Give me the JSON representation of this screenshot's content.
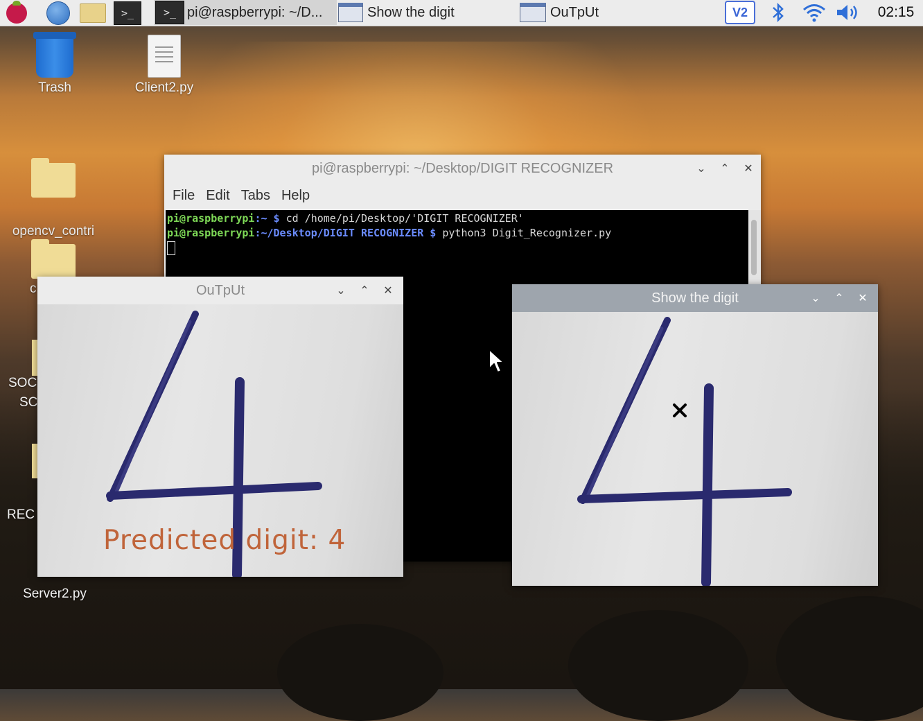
{
  "taskbar": {
    "tasks": [
      {
        "label": "pi@raspberrypi: ~/D...",
        "active": true
      },
      {
        "label": "Show the digit",
        "active": false
      },
      {
        "label": "OuTpUt",
        "active": false
      }
    ],
    "tray": {
      "vnc": "V2",
      "clock": "02:15"
    },
    "icons": [
      "raspberry-menu-icon",
      "web-browser-icon",
      "file-manager-icon",
      "terminal-icon"
    ]
  },
  "desktop": {
    "icons": [
      {
        "label": "Trash"
      },
      {
        "label": "Client2.py"
      },
      {
        "label": "opencv_contri\nb"
      },
      {
        "label": "c"
      },
      {
        "label": "SOC"
      },
      {
        "label": "SC"
      },
      {
        "label": "REC"
      },
      {
        "label": "Server2.py"
      }
    ]
  },
  "terminal": {
    "title": "pi@raspberrypi: ~/Desktop/DIGIT RECOGNIZER",
    "menu": [
      "File",
      "Edit",
      "Tabs",
      "Help"
    ],
    "lines": [
      {
        "user": "pi@raspberrypi",
        "path": ":~ $",
        "cmd": " cd /home/pi/Desktop/'DIGIT RECOGNIZER'"
      },
      {
        "user": "pi@raspberrypi",
        "path": ":~/Desktop/DIGIT RECOGNIZER $",
        "cmd": " python3 Digit_Recognizer.py"
      }
    ]
  },
  "output_window": {
    "title": "OuTpUt",
    "prediction": "Predicted digit: 4"
  },
  "show_window": {
    "title": "Show the digit"
  },
  "colors": {
    "prompt_user": "#7ed957",
    "prompt_path": "#6b8cff",
    "prediction_text": "#c0643a",
    "digit_ink": "#2a2a6e"
  }
}
